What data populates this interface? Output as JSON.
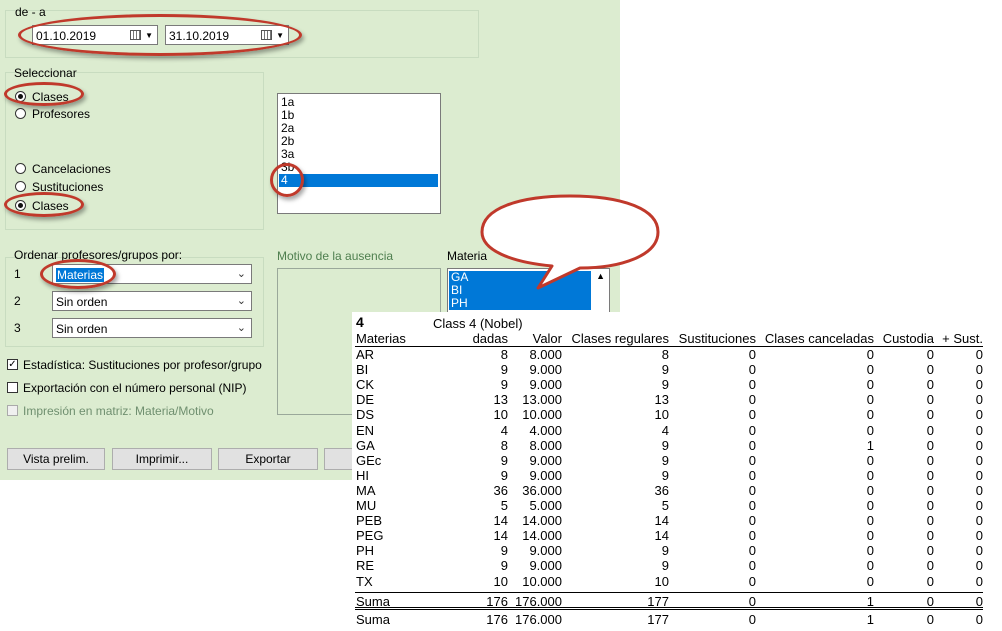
{
  "dialog": {
    "date_range": {
      "label": "de - a",
      "from": "01.10.2019",
      "to": "31.10.2019"
    },
    "select": {
      "label": "Seleccionar",
      "option_classes": "Clases",
      "option_teachers": "Profesores",
      "option_cancellations": "Cancelaciones",
      "option_substitutions": "Sustituciones",
      "option_classes2": "Clases"
    },
    "class_list": {
      "items": [
        "1a",
        "1b",
        "2a",
        "2b",
        "3a",
        "3b",
        "4"
      ],
      "selected": "4"
    },
    "order": {
      "label": "Ordenar profesores/grupos por:",
      "rows": [
        {
          "num": "1",
          "value": "Materias"
        },
        {
          "num": "2",
          "value": "Sin orden"
        },
        {
          "num": "3",
          "value": "Sin orden"
        }
      ]
    },
    "absence_reason_label": "Motivo de la ausencia",
    "subject": {
      "label": "Materia",
      "items": [
        "GA",
        "BI",
        "PH"
      ]
    },
    "checkboxes": {
      "stats": "Estadística: Sustituciones por profesor/grupo",
      "export_nip": "Exportación con el número personal (NIP)",
      "matrix": "Impresión en matriz: Materia/Motivo"
    },
    "buttons": {
      "preview": "Vista prelim.",
      "print": "Imprimir...",
      "export": "Exportar"
    }
  },
  "report": {
    "number": "4",
    "title": "Class 4 (Nobel)",
    "headers": [
      "Materias",
      "dadas",
      "Valor",
      "Clases regulares",
      "Sustituciones",
      "Clases canceladas",
      "Custodia",
      "+ Sust."
    ],
    "rows": [
      [
        "AR",
        "8",
        "8.000",
        "8",
        "0",
        "0",
        "0",
        "0"
      ],
      [
        "BI",
        "9",
        "9.000",
        "9",
        "0",
        "0",
        "0",
        "0"
      ],
      [
        "CK",
        "9",
        "9.000",
        "9",
        "0",
        "0",
        "0",
        "0"
      ],
      [
        "DE",
        "13",
        "13.000",
        "13",
        "0",
        "0",
        "0",
        "0"
      ],
      [
        "DS",
        "10",
        "10.000",
        "10",
        "0",
        "0",
        "0",
        "0"
      ],
      [
        "EN",
        "4",
        "4.000",
        "4",
        "0",
        "0",
        "0",
        "0"
      ],
      [
        "GA",
        "8",
        "8.000",
        "9",
        "0",
        "1",
        "0",
        "0"
      ],
      [
        "GEc",
        "9",
        "9.000",
        "9",
        "0",
        "0",
        "0",
        "0"
      ],
      [
        "HI",
        "9",
        "9.000",
        "9",
        "0",
        "0",
        "0",
        "0"
      ],
      [
        "MA",
        "36",
        "36.000",
        "36",
        "0",
        "0",
        "0",
        "0"
      ],
      [
        "MU",
        "5",
        "5.000",
        "5",
        "0",
        "0",
        "0",
        "0"
      ],
      [
        "PEB",
        "14",
        "14.000",
        "14",
        "0",
        "0",
        "0",
        "0"
      ],
      [
        "PEG",
        "14",
        "14.000",
        "14",
        "0",
        "0",
        "0",
        "0"
      ],
      [
        "PH",
        "9",
        "9.000",
        "9",
        "0",
        "0",
        "0",
        "0"
      ],
      [
        "RE",
        "9",
        "9.000",
        "9",
        "0",
        "0",
        "0",
        "0"
      ],
      [
        "TX",
        "10",
        "10.000",
        "10",
        "0",
        "0",
        "0",
        "0"
      ]
    ],
    "totals": [
      [
        "Suma",
        "176",
        "176.000",
        "177",
        "0",
        "1",
        "0",
        "0"
      ],
      [
        "Suma",
        "176",
        "176.000",
        "177",
        "0",
        "1",
        "0",
        "0"
      ]
    ]
  }
}
